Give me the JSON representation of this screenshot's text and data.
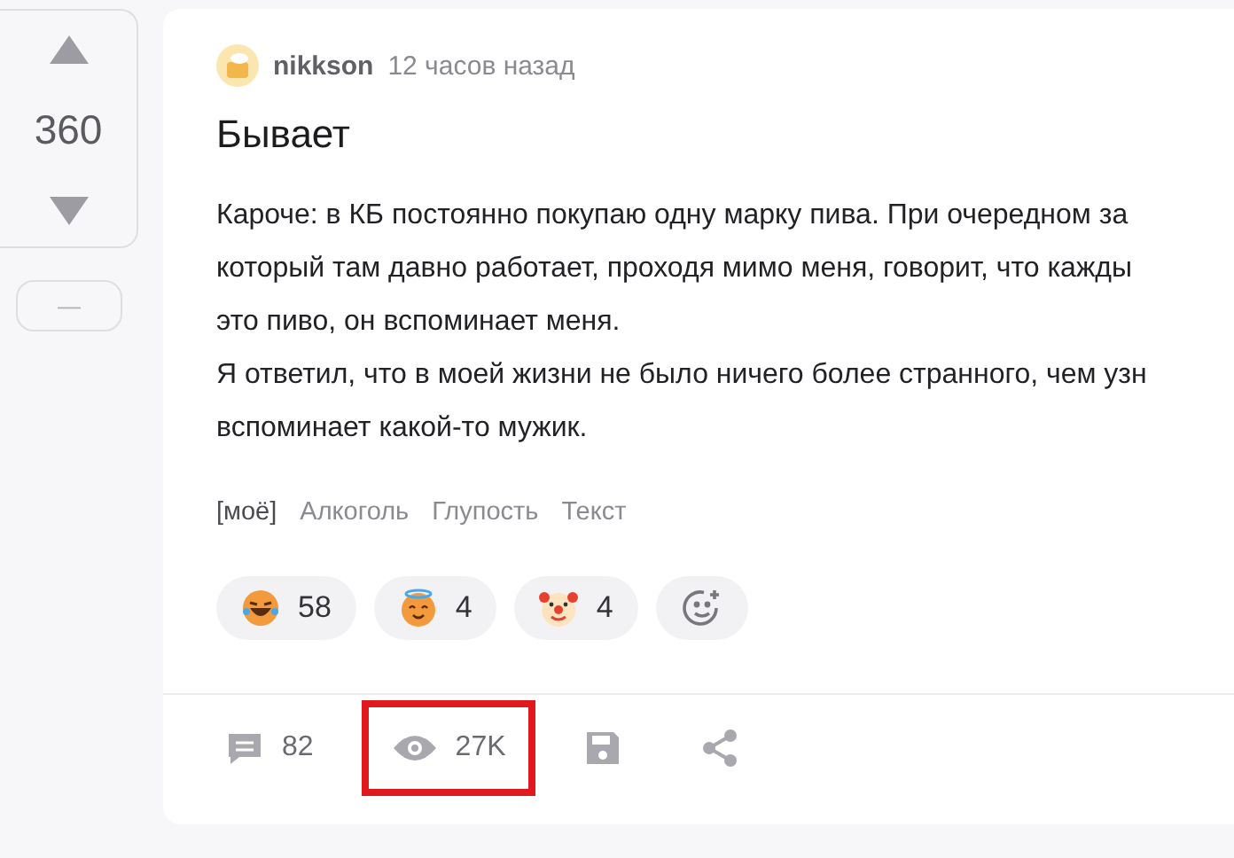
{
  "vote": {
    "score": "360",
    "collapse": "—"
  },
  "post": {
    "author": "nikkson",
    "time": "12 часов назад",
    "title": "Бывает",
    "lines": [
      "Кароче: в КБ постоянно покупаю одну марку пива. При очередном за",
      "который там давно работает, проходя мимо меня, говорит, что кажды",
      "это пиво, он вспоминает меня.",
      "Я ответил, что в моей жизни не было ничего более странного, чем узн",
      "вспоминает какой-то мужик."
    ],
    "tags": [
      {
        "label": "[моё]",
        "kind": "own"
      },
      {
        "label": "Алкоголь",
        "kind": "tag"
      },
      {
        "label": "Глупость",
        "kind": "tag"
      },
      {
        "label": "Текст",
        "kind": "tag"
      }
    ],
    "reactions": [
      {
        "kind": "laugh",
        "count": "58"
      },
      {
        "kind": "halo",
        "count": "4"
      },
      {
        "kind": "clown",
        "count": "4"
      },
      {
        "kind": "add"
      }
    ],
    "stats": [
      {
        "kind": "comments",
        "count": "82",
        "highlighted": false
      },
      {
        "kind": "views",
        "count": "27K",
        "highlighted": true
      },
      {
        "kind": "save",
        "highlighted": false
      },
      {
        "kind": "share",
        "highlighted": false
      }
    ]
  }
}
